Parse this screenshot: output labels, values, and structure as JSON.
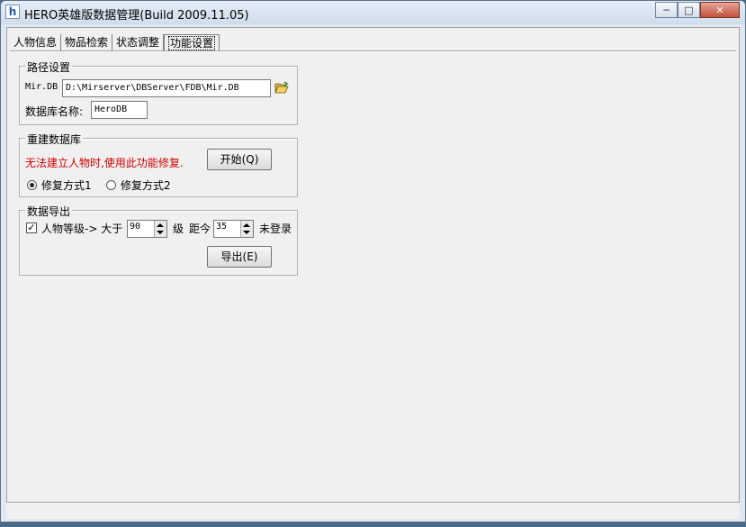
{
  "window": {
    "title": "HERO英雄版数据管理(Build 2009.11.05)",
    "app_icon": "h",
    "buttons": {
      "minimize": "─",
      "maximize": "□",
      "close": "✕"
    }
  },
  "tabs": [
    {
      "label": "人物信息",
      "active": false
    },
    {
      "label": "物品检索",
      "active": false
    },
    {
      "label": "状态调整",
      "active": false
    },
    {
      "label": "功能设置",
      "active": true
    }
  ],
  "path_group": {
    "legend": "路径设置",
    "mirdb_label": "Mir.DB",
    "mirdb_value": "D:\\Mirserver\\DBServer\\FDB\\Mir.DB",
    "dbname_label": "数据库名称:",
    "dbname_value": "HeroDB"
  },
  "rebuild_group": {
    "legend": "重建数据库",
    "warning": "无法建立人物时,使用此功能修复.",
    "warning_color": "#d00000",
    "start_button": "开始(Q)",
    "option1": "修复方式1",
    "option2": "修复方式2",
    "selected_option": 1
  },
  "export_group": {
    "legend": "数据导出",
    "level_label": "人物等级-> 大于",
    "level_checked": true,
    "level_value": "90",
    "level_unit": "级",
    "days_label": "距今",
    "days_value": "35",
    "days_suffix": "未登录",
    "export_button": "导出(E)"
  }
}
